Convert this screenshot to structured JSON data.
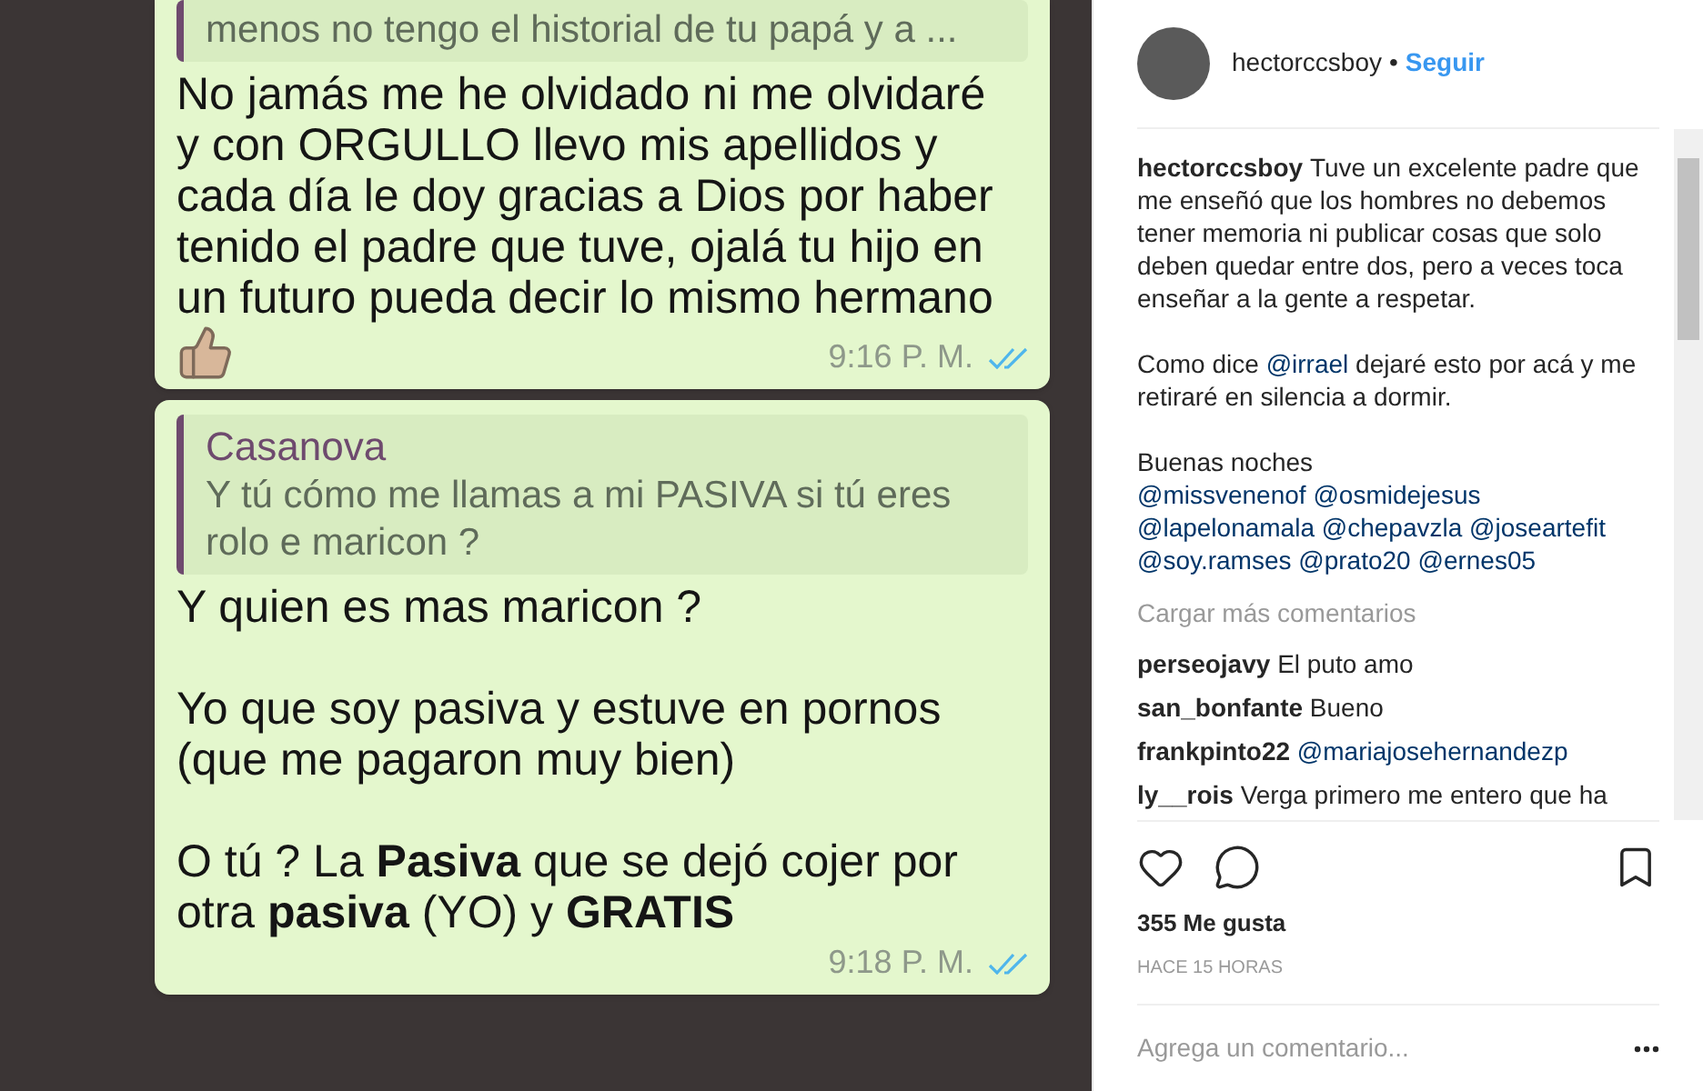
{
  "post_image": {
    "messages": [
      {
        "quote": {
          "text": "menos no tengo el historial de tu papá y a ..."
        },
        "body": "No jamás me he olvidado ni me olvidaré\ny con ORGULLO llevo mis apellidos y\ncada día le doy gracias a Dios por haber\ntenido el padre que tuve, ojalá tu hijo en\nun futuro pueda decir lo mismo hermano",
        "thumbs_up": true,
        "time": "9:16 P. M.",
        "read": true
      },
      {
        "quote": {
          "author": "Casanova",
          "text": "Y tú cómo me llamas a mi PASIVA si tú eres\nrolo e maricon ?"
        },
        "body": "Y quien es mas maricon ?\n\nYo que soy pasiva y estuve en pornos\n(que me pagaron muy bien)\n\nO tú ? La **Pasiva** que se dejó cojer por\notra **pasiva** (YO) y **GRATIS**",
        "thumbs_up": false,
        "time": "9:18 P. M.",
        "read": true
      }
    ]
  },
  "header": {
    "username": "hectorccsboy",
    "separator": "•",
    "follow": "Seguir"
  },
  "caption": {
    "username": "hectorccsboy",
    "paragraphs": [
      [
        {
          "kind": "text",
          "text": "Tuve un excelente padre que me enseñó que los hombres no debemos tener memoria ni publicar cosas que solo deben quedar entre dos, pero a veces toca enseñar a la gente a respetar."
        }
      ],
      [
        {
          "kind": "text",
          "text": "Como dice "
        },
        {
          "kind": "mention",
          "text": "@irrael"
        },
        {
          "kind": "text",
          "text": " dejaré esto por acá y me retiraré en silencia a dormir."
        }
      ],
      [
        {
          "kind": "text",
          "text": "Buenas noches"
        },
        {
          "kind": "break"
        },
        {
          "kind": "mention",
          "text": "@missvenenof"
        },
        {
          "kind": "mention",
          "text": "@osmidejesus"
        },
        {
          "kind": "mention",
          "text": "@lapelonamala"
        },
        {
          "kind": "mention",
          "text": "@chepavzla"
        },
        {
          "kind": "mention",
          "text": "@joseartefit"
        },
        {
          "kind": "mention",
          "text": "@soy.ramses"
        },
        {
          "kind": "mention",
          "text": "@prato20"
        },
        {
          "kind": "mention",
          "text": "@ernes05"
        }
      ]
    ]
  },
  "load_more": "Cargar más comentarios",
  "comments": [
    {
      "user": "perseojavy",
      "kind": "text",
      "text": "El puto amo"
    },
    {
      "user": "san_bonfante",
      "kind": "text",
      "text": "Bueno"
    },
    {
      "user": "frankpinto22",
      "kind": "mention",
      "text": "@mariajosehernandezp"
    },
    {
      "user": "ly__rois",
      "kind": "text",
      "text": "Verga primero me entero que ha"
    }
  ],
  "likes": "355 Me gusta",
  "time": "HACE 15 HORAS",
  "comment_box": {
    "placeholder": "Agrega un comentario..."
  }
}
